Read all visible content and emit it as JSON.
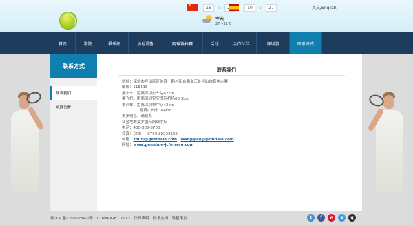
{
  "clock": {
    "china_hour": "16",
    "china_minute": "26",
    "spain_hour": "10",
    "spain_minute": "27",
    "separator": ":"
  },
  "weather": {
    "today_label": "今天",
    "temperature": "27～31℃"
  },
  "header": {
    "language_switch": "英文/English"
  },
  "nav": {
    "items": [
      "首页",
      "学院",
      "俱乐部",
      "场地设施",
      "网球锦标赛",
      "活动",
      "合作伙伴",
      "深圳游",
      "联系方式"
    ],
    "active_index": 8
  },
  "sidebar": {
    "heading": "联系方式",
    "items": [
      "联系我们",
      "地理位置"
    ],
    "active_index": 0
  },
  "content": {
    "title": "联系我们",
    "lines": [
      "地址：深圳市坪山新区体育一路与新合路交汇处坪山体育中心旁",
      "邮编：518118",
      "乘火车：距离深圳火车站42km",
      "乘飞机：距离深圳宝安国际机场66.3km",
      "乘汽车：距离深圳市中心42km",
      "距离广州市164km",
      "更多信息，请联系：",
      "弘金地赛夏罗国际网球学院",
      "电话：400-838-5700",
      "传真：（86）－0755 28339162"
    ],
    "email_label": "邮箱：",
    "email_1": "zhuxl@gemdale.com",
    "email_separator": "，",
    "email_2": "wangqian@gemdale.com",
    "website_label": "网址：",
    "website": "www.gemdale-jcferrero.com"
  },
  "footer": {
    "icp": "粤 ICP 备12052754-1号",
    "copyright": "COPYRIGHT 2013",
    "legal": "法律声明",
    "support": "技术支持：致星策划"
  },
  "colors": {
    "nav_bg": "#1e3d5e",
    "accent": "#0f7fb0",
    "link": "#1a5fa3"
  }
}
